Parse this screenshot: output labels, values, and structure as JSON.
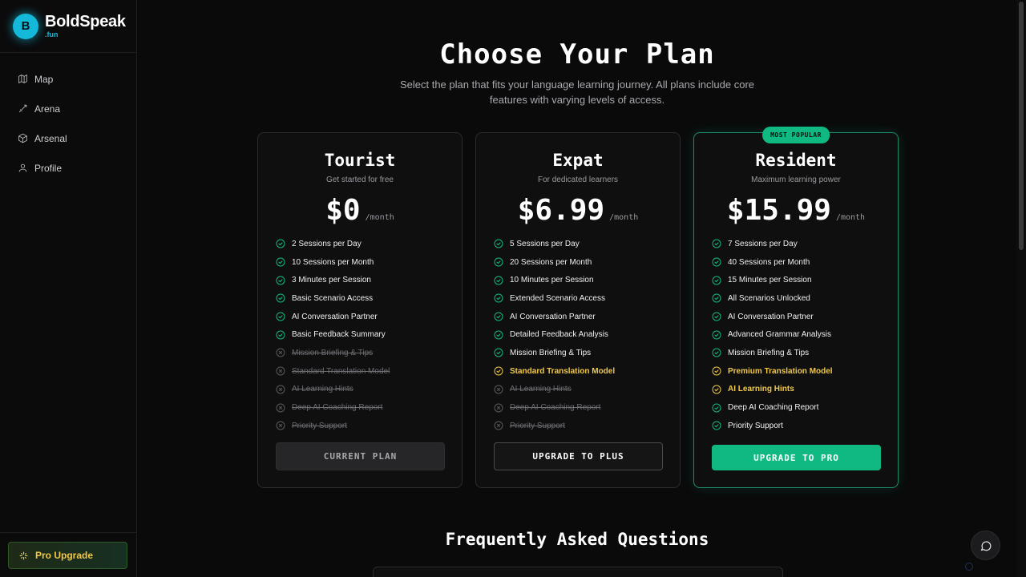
{
  "brand": {
    "name": "BoldSpeak",
    "suffix": ".fun",
    "logo_letter": "B"
  },
  "sidebar": {
    "items": [
      {
        "label": "Map",
        "icon": "map-icon"
      },
      {
        "label": "Arena",
        "icon": "sword-icon"
      },
      {
        "label": "Arsenal",
        "icon": "box-icon"
      },
      {
        "label": "Profile",
        "icon": "user-icon"
      }
    ],
    "pro_upgrade_label": "Pro Upgrade"
  },
  "header": {
    "title": "Choose Your Plan",
    "subtitle": "Select the plan that fits your language learning journey. All plans include core features with varying levels of access."
  },
  "plans": [
    {
      "name": "Tourist",
      "tagline": "Get started for free",
      "price": "$0",
      "period": "/month",
      "features": [
        {
          "text": "2 Sessions per Day",
          "state": "on"
        },
        {
          "text": "10 Sessions per Month",
          "state": "on"
        },
        {
          "text": "3 Minutes per Session",
          "state": "on"
        },
        {
          "text": "Basic Scenario Access",
          "state": "on"
        },
        {
          "text": "AI Conversation Partner",
          "state": "on"
        },
        {
          "text": "Basic Feedback Summary",
          "state": "on"
        },
        {
          "text": "Mission Briefing & Tips",
          "state": "off"
        },
        {
          "text": "Standard Translation Model",
          "state": "off"
        },
        {
          "text": "AI Learning Hints",
          "state": "off"
        },
        {
          "text": "Deep AI Coaching Report",
          "state": "off"
        },
        {
          "text": "Priority Support",
          "state": "off"
        }
      ],
      "cta": "CURRENT PLAN"
    },
    {
      "name": "Expat",
      "tagline": "For dedicated learners",
      "price": "$6.99",
      "period": "/month",
      "features": [
        {
          "text": "5 Sessions per Day",
          "state": "on"
        },
        {
          "text": "20 Sessions per Month",
          "state": "on"
        },
        {
          "text": "10 Minutes per Session",
          "state": "on"
        },
        {
          "text": "Extended Scenario Access",
          "state": "on"
        },
        {
          "text": "AI Conversation Partner",
          "state": "on"
        },
        {
          "text": "Detailed Feedback Analysis",
          "state": "on"
        },
        {
          "text": "Mission Briefing & Tips",
          "state": "on"
        },
        {
          "text": "Standard Translation Model",
          "state": "highlight"
        },
        {
          "text": "AI Learning Hints",
          "state": "off"
        },
        {
          "text": "Deep AI Coaching Report",
          "state": "off"
        },
        {
          "text": "Priority Support",
          "state": "off"
        }
      ],
      "cta": "UPGRADE TO PLUS"
    },
    {
      "name": "Resident",
      "tagline": "Maximum learning power",
      "price": "$15.99",
      "period": "/month",
      "badge": "MOST POPULAR",
      "features": [
        {
          "text": "7 Sessions per Day",
          "state": "on"
        },
        {
          "text": "40 Sessions per Month",
          "state": "on"
        },
        {
          "text": "15 Minutes per Session",
          "state": "on"
        },
        {
          "text": "All Scenarios Unlocked",
          "state": "on"
        },
        {
          "text": "AI Conversation Partner",
          "state": "on"
        },
        {
          "text": "Advanced Grammar Analysis",
          "state": "on"
        },
        {
          "text": "Mission Briefing & Tips",
          "state": "on"
        },
        {
          "text": "Premium Translation Model",
          "state": "highlight"
        },
        {
          "text": "AI Learning Hints",
          "state": "highlight"
        },
        {
          "text": "Deep AI Coaching Report",
          "state": "on"
        },
        {
          "text": "Priority Support",
          "state": "on"
        }
      ],
      "cta": "UPGRADE TO PRO"
    }
  ],
  "faq": {
    "title": "Frequently Asked Questions"
  },
  "colors": {
    "accent": "#10b981",
    "brand": "#14b8d8",
    "highlight": "#f0c94a",
    "background": "#0a0a0b"
  }
}
